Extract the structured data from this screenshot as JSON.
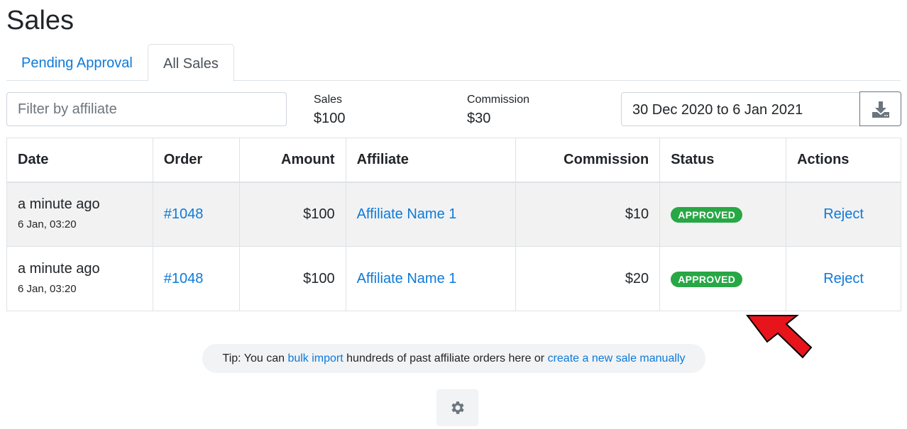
{
  "page": {
    "title": "Sales"
  },
  "tabs": [
    {
      "label": "Pending Approval",
      "active": false
    },
    {
      "label": "All Sales",
      "active": true
    }
  ],
  "filter": {
    "placeholder": "Filter by affiliate",
    "value": ""
  },
  "stats": {
    "sales": {
      "label": "Sales",
      "value": "$100"
    },
    "commission": {
      "label": "Commission",
      "value": "$30"
    }
  },
  "date_range": {
    "value": "30 Dec 2020 to 6 Jan 2021"
  },
  "download": {
    "icon": "download-icon"
  },
  "table": {
    "headers": {
      "date": "Date",
      "order": "Order",
      "amount": "Amount",
      "affiliate": "Affiliate",
      "commission": "Commission",
      "status": "Status",
      "actions": "Actions"
    },
    "rows": [
      {
        "relative_time": "a minute ago",
        "timestamp": "6 Jan, 03:20",
        "order": "#1048",
        "amount": "$100",
        "affiliate": "Affiliate Name 1",
        "commission": "$10",
        "status": "APPROVED",
        "action": "Reject"
      },
      {
        "relative_time": "a minute ago",
        "timestamp": "6 Jan, 03:20",
        "order": "#1048",
        "amount": "$100",
        "affiliate": "Affiliate Name 1",
        "commission": "$20",
        "status": "APPROVED",
        "action": "Reject"
      }
    ]
  },
  "tip": {
    "prefix": "Tip: You can ",
    "link1": "bulk import",
    "middle": " hundreds of past affiliate orders here or ",
    "link2": "create a new sale manually"
  },
  "settings": {
    "icon": "gear-icon"
  },
  "colors": {
    "link": "#0d7ad9",
    "approved_badge": "#28a745",
    "annotation_arrow": "#e8141c"
  }
}
